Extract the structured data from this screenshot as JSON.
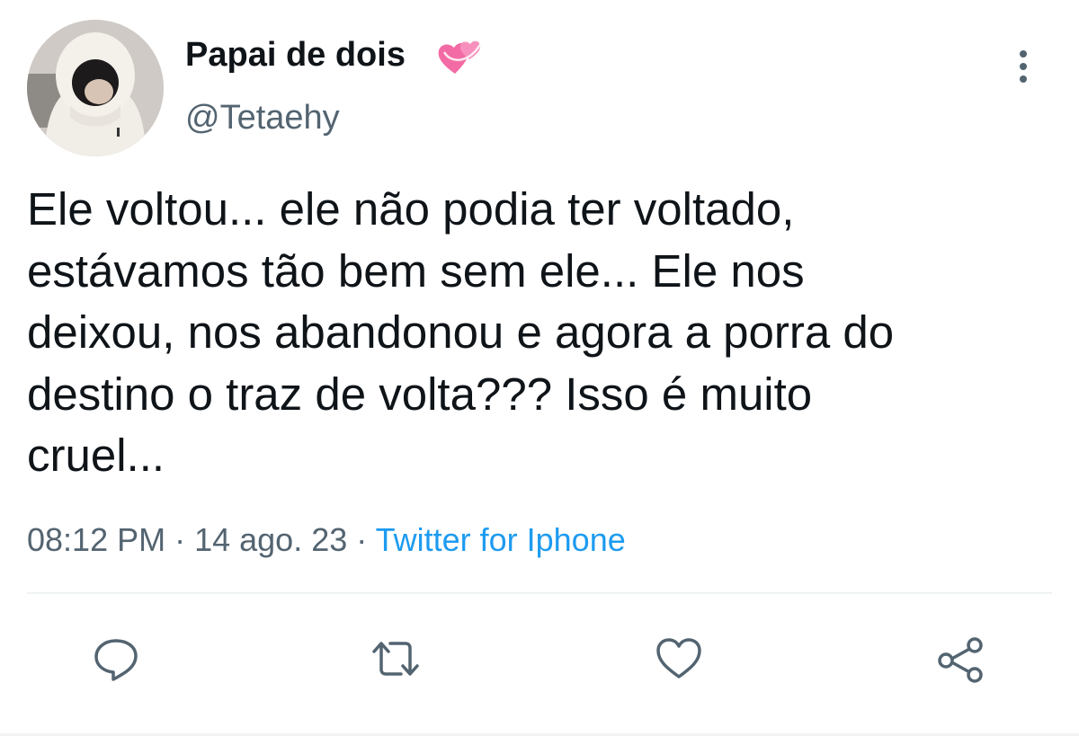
{
  "author": {
    "display_name": "Papai de dois",
    "handle": "@Tetaehy",
    "name_emoji_icon": "two-hearts-icon"
  },
  "tweet": {
    "text_lines": [
      "Ele voltou... ele não podia ter voltado,",
      "estávamos tão bem sem ele... Ele nos",
      "deixou, nos abandonou e agora a porra do",
      "destino o traz de volta??? Isso é muito",
      "cruel..."
    ],
    "time": "08:12 PM",
    "separator": " · ",
    "date": "14 ago. 23",
    "source": "Twitter for Iphone"
  },
  "actions": [
    {
      "name": "reply",
      "icon": "speech-bubble-icon"
    },
    {
      "name": "retweet",
      "icon": "retweet-arrows-icon"
    },
    {
      "name": "like",
      "icon": "heart-icon"
    },
    {
      "name": "share",
      "icon": "share-nodes-icon"
    }
  ],
  "colors": {
    "text_primary": "#0f1419",
    "text_secondary": "#536471",
    "link": "#1d9bf0",
    "icon": "#536471",
    "divider": "#eff3f4",
    "emoji_pink": "#f36ba4"
  }
}
